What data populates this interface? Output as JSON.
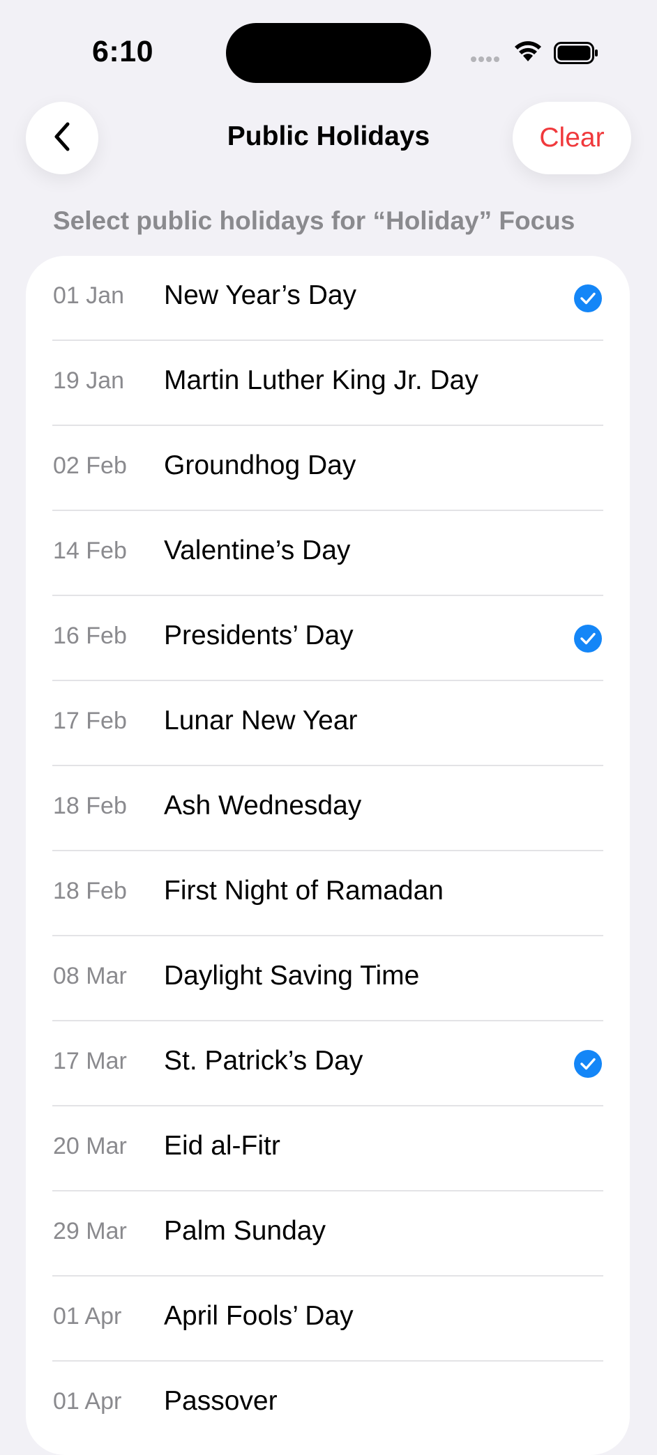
{
  "status_bar": {
    "time": "6:10"
  },
  "nav": {
    "title": "Public Holidays",
    "clear_label": "Clear"
  },
  "section_header": "Select public holidays for “Holiday” Focus",
  "accent_color": "#1486f7",
  "destructive_color": "#f0393c",
  "holidays": [
    {
      "date": "01 Jan",
      "name": "New Year’s Day",
      "selected": true
    },
    {
      "date": "19 Jan",
      "name": "Martin Luther King Jr. Day",
      "selected": false
    },
    {
      "date": "02 Feb",
      "name": "Groundhog Day",
      "selected": false
    },
    {
      "date": "14 Feb",
      "name": "Valentine’s Day",
      "selected": false
    },
    {
      "date": "16 Feb",
      "name": "Presidents’ Day",
      "selected": true
    },
    {
      "date": "17 Feb",
      "name": "Lunar New Year",
      "selected": false
    },
    {
      "date": "18 Feb",
      "name": "Ash Wednesday",
      "selected": false
    },
    {
      "date": "18 Feb",
      "name": "First Night of Ramadan",
      "selected": false
    },
    {
      "date": "08 Mar",
      "name": "Daylight Saving Time",
      "selected": false
    },
    {
      "date": "17 Mar",
      "name": "St. Patrick’s Day",
      "selected": true
    },
    {
      "date": "20 Mar",
      "name": "Eid al-Fitr",
      "selected": false
    },
    {
      "date": "29 Mar",
      "name": "Palm Sunday",
      "selected": false
    },
    {
      "date": "01 Apr",
      "name": "April Fools’ Day",
      "selected": false
    },
    {
      "date": "01 Apr",
      "name": "Passover",
      "selected": false
    }
  ]
}
